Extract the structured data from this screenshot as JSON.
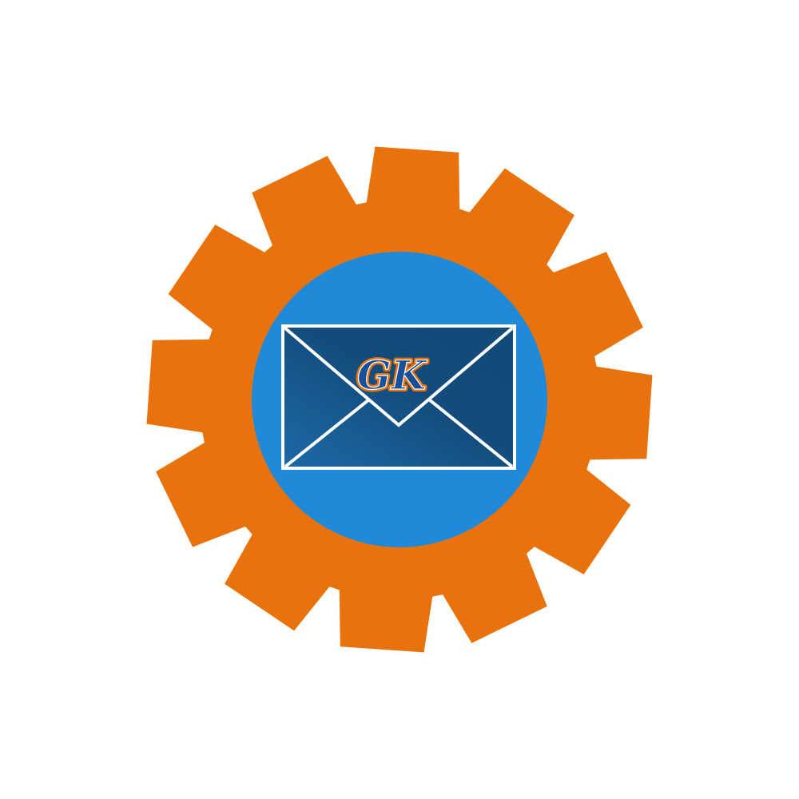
{
  "logo": {
    "icon": "gear-envelope-logo",
    "monogram": "GK",
    "colors": {
      "background": "#ffffff",
      "gear": "#e8730c",
      "circle": "#1e8ad9",
      "envelope_light": "#1c6aa8",
      "envelope_dark": "#134c7c",
      "envelope_stroke": "#ffffff",
      "monogram_fill": "#1a4f9a",
      "monogram_outline": "#e8730c"
    }
  }
}
